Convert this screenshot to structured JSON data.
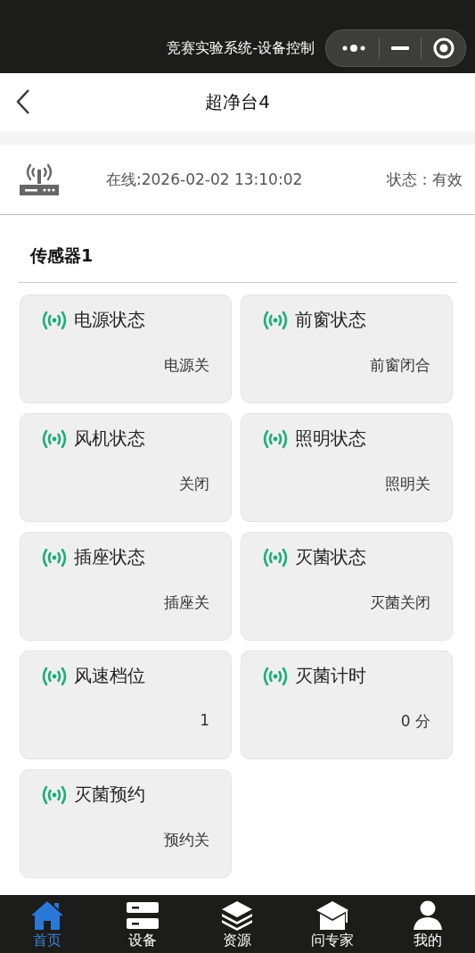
{
  "window": {
    "title": "竞赛实验系统-设备控制"
  },
  "nav": {
    "title": "超净台4"
  },
  "device": {
    "online": "在线:2026-02-02 13:10:02",
    "status": "状态：有效"
  },
  "section": {
    "title": "传感器1"
  },
  "sensors": [
    {
      "name": "电源状态",
      "value": "电源关"
    },
    {
      "name": "前窗状态",
      "value": "前窗闭合"
    },
    {
      "name": "风机状态",
      "value": "关闭"
    },
    {
      "name": "照明状态",
      "value": "照明关"
    },
    {
      "name": "插座状态",
      "value": "插座关"
    },
    {
      "name": "灭菌状态",
      "value": "灭菌关闭"
    },
    {
      "name": "风速档位",
      "value": "1"
    },
    {
      "name": "灭菌计时",
      "value": "0 分"
    },
    {
      "name": "灭菌预约",
      "value": "预约关"
    }
  ],
  "tabs": [
    {
      "label": "首页",
      "kind": "home",
      "selected": true
    },
    {
      "label": "设备",
      "kind": "device",
      "selected": false
    },
    {
      "label": "资源",
      "kind": "layers",
      "selected": false
    },
    {
      "label": "问专家",
      "kind": "cap",
      "selected": false
    },
    {
      "label": "我的",
      "kind": "user",
      "selected": false
    }
  ]
}
